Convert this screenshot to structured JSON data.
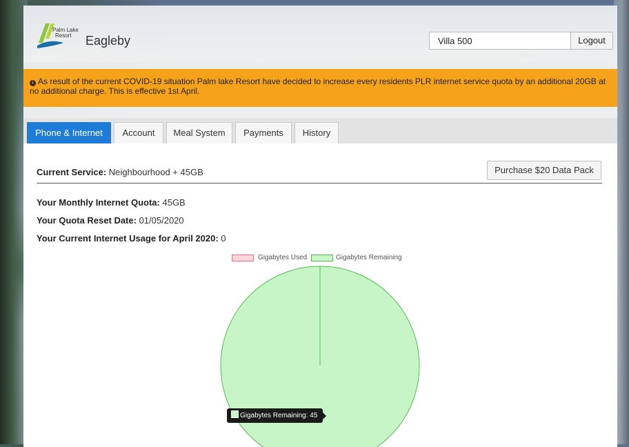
{
  "header": {
    "logo_text_line1": "Palm Lake",
    "logo_text_line2": "Resort",
    "site_name": "Eagleby",
    "villa_selected": "Villa 500",
    "logout_label": "Logout"
  },
  "alert": {
    "text": "As result of the current COVID-19 situation Palm lake Resort have decided to increase every residents PLR internet service quota by an additional 20GB at no additional charge. This is effective 1st April."
  },
  "tabs": [
    {
      "label": "Phone & Internet",
      "active": true
    },
    {
      "label": "Account",
      "active": false
    },
    {
      "label": "Meal System",
      "active": false
    },
    {
      "label": "Payments",
      "active": false
    },
    {
      "label": "History",
      "active": false
    }
  ],
  "service": {
    "current_label": "Current Service:",
    "current_value": "Neighbourhood + 45GB",
    "purchase_label": "Purchase $20 Data Pack",
    "quota_label": "Your Monthly Internet Quota:",
    "quota_value": "45GB",
    "reset_label": "Your Quota Reset Date:",
    "reset_value": "01/05/2020",
    "usage_label": "Your Current Internet Usage for April 2020:",
    "usage_value": "0"
  },
  "chart_data": {
    "type": "pie",
    "title": "",
    "categories": [
      "Gigabytes Used",
      "Gigabytes Remaining"
    ],
    "values": [
      0,
      45
    ],
    "colors": [
      "#ffd6dc",
      "#c8f5c8"
    ],
    "border_colors": [
      "#ff6384",
      "#4bc04b"
    ],
    "legend_position": "top",
    "tooltip": "Gigabytes Remaining: 45"
  }
}
